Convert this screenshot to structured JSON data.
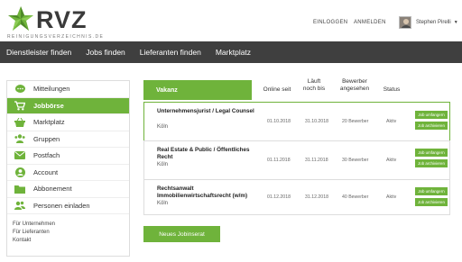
{
  "brand": {
    "name": "RVZ",
    "tagline": "REINIGUNGSVERZEICHNIS.DE"
  },
  "header": {
    "login": "EINLOGGEN",
    "register": "ANMELDEN",
    "user_name": "Stephen Pirelli"
  },
  "nav": [
    "Dienstleister finden",
    "Jobs finden",
    "Lieferanten finden",
    "Marktplatz"
  ],
  "sidebar": {
    "items": [
      {
        "label": "Mitteilungen",
        "icon": "speech-bubble-icon"
      },
      {
        "label": "Jobbörse",
        "icon": "cart-icon"
      },
      {
        "label": "Marktplatz",
        "icon": "basket-icon"
      },
      {
        "label": "Gruppen",
        "icon": "group-icon"
      },
      {
        "label": "Postfach",
        "icon": "envelope-icon"
      },
      {
        "label": "Account",
        "icon": "user-icon"
      },
      {
        "label": "Abbonement",
        "icon": "folder-icon"
      },
      {
        "label": "Personen einladen",
        "icon": "invite-people-icon"
      }
    ],
    "footer_links": [
      "Für Unternehmen",
      "Für Lieferanten",
      "Kontakt"
    ]
  },
  "table": {
    "headers": {
      "vakanz": "Vakanz",
      "online": "Online seit",
      "laeuft": "Läuft noch bis",
      "bewerber": "Bewerber angesehen",
      "status": "Status"
    },
    "rows": [
      {
        "title": "Unternehmensjurist / Legal Counsel",
        "location": "Köln",
        "online": "01.10.2018",
        "until": "31.10.2018",
        "applicants": "20 Bewerber",
        "status": "Aktiv"
      },
      {
        "title": "Real Estate & Public / Öffentliches Recht",
        "location": "Köln",
        "online": "01.11.2018",
        "until": "31.11.2018",
        "applicants": "30 Bewerber",
        "status": "Aktiv"
      },
      {
        "title": "Rechtsanwalt Immobilienwirtschaftsrecht (w/m)",
        "location": "Köln",
        "online": "01.12.2018",
        "until": "31.12.2018",
        "applicants": "40 Bewerber",
        "status": "Aktiv"
      }
    ],
    "btn_edit": "Job umfangern",
    "btn_archive": "Job archivieren"
  },
  "new_job_button": "Neues Jobinserat",
  "colors": {
    "accent": "#6fb33b",
    "nav_bg": "#3f3f3f"
  }
}
